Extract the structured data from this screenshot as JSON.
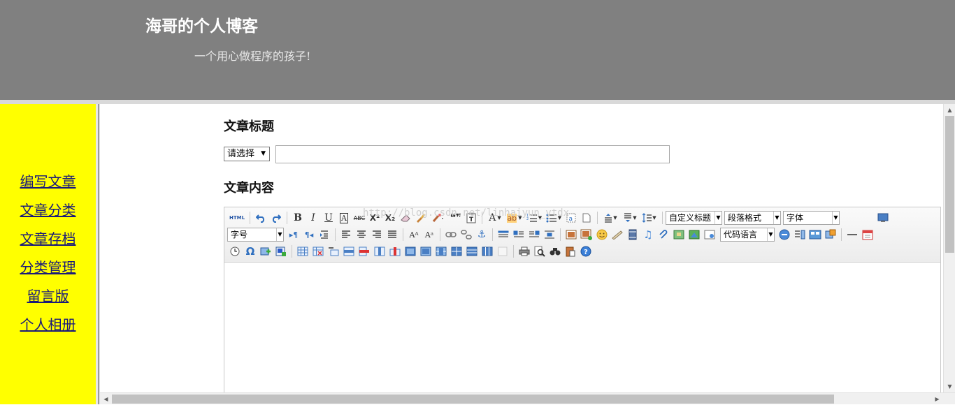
{
  "header": {
    "title": "海哥的个人博客",
    "subtitle": "一个用心做程序的孩子!"
  },
  "sidebar": {
    "items": [
      {
        "label": "编写文章"
      },
      {
        "label": "文章分类"
      },
      {
        "label": "文章存档"
      },
      {
        "label": "分类管理"
      },
      {
        "label": "留言版"
      },
      {
        "label": "个人相册"
      }
    ]
  },
  "form": {
    "title_label": "文章标题",
    "category_select": "请选择",
    "content_label": "文章内容"
  },
  "editor": {
    "watermark": "http://blog.csdn.net/linhaiyun_ytdx",
    "combos": {
      "custom_heading": "自定义标题",
      "paragraph_format": "段落格式",
      "font_family": "字体",
      "font_size": "字号",
      "code_language": "代码语言"
    },
    "icons": {
      "html": "HTML",
      "bold": "B",
      "italic": "I",
      "underline": "U",
      "font_border": "A",
      "strikethrough": "ABC",
      "superscript": "X²",
      "subscript": "X₂",
      "blockquote": "❝❞",
      "font_color": "A",
      "highlight": "ab",
      "special_char": "Ω",
      "table": "table-icon"
    }
  },
  "colors": {
    "header_bg": "#808080",
    "sidebar_bg": "#ffff00",
    "nav_link": "#1a1a7a"
  }
}
